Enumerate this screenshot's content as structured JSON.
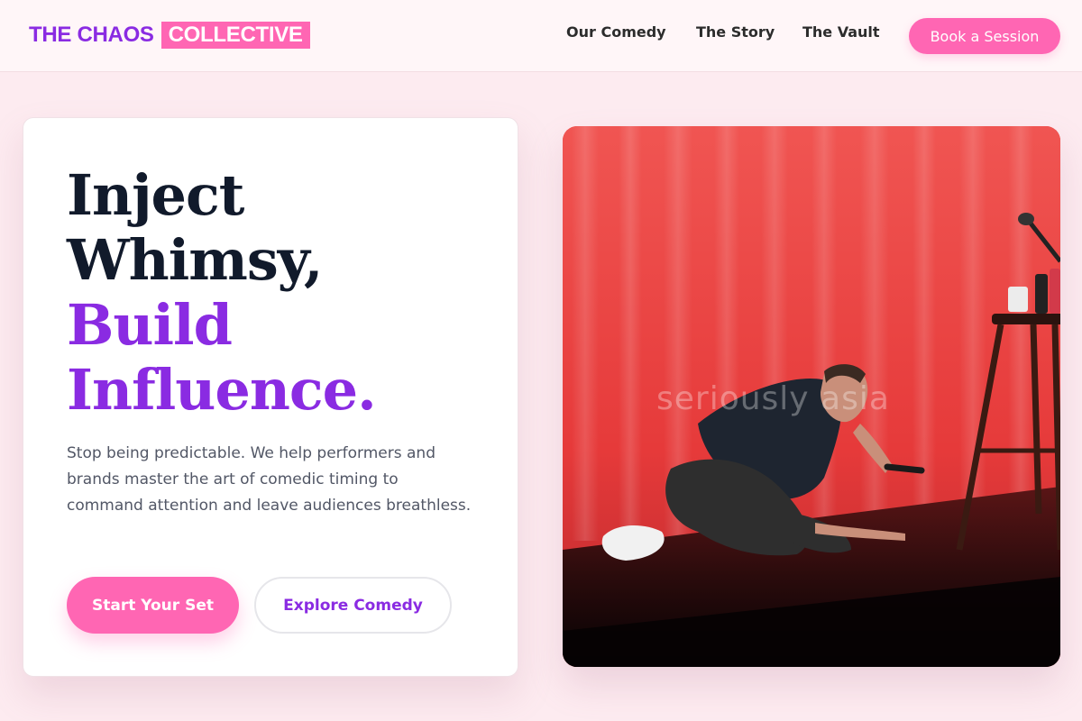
{
  "brand": {
    "name": "THE CHAOS",
    "tag": "COLLECTIVE",
    "primary_color": "#8a2be2",
    "accent_color": "#ff66b3"
  },
  "nav": {
    "links": [
      "Our Comedy",
      "The Story",
      "The Vault"
    ],
    "cta": "Book a Session"
  },
  "hero": {
    "headline_dark": [
      "Inject",
      "Whimsy,"
    ],
    "headline_accent": [
      "Build",
      "Influence."
    ],
    "subcopy": "Stop being predictable. We help performers and brands master the art of comedic timing to command attention and leave audiences breathless.",
    "primary_button": "Start Your Set",
    "secondary_button": "Explore Comedy"
  },
  "photo": {
    "subject": "comedian-on-stage-photo",
    "watermark": "seriously asia"
  }
}
